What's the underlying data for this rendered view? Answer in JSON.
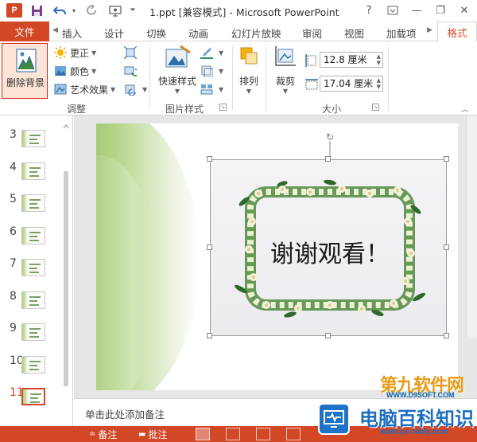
{
  "window": {
    "app_logo": "P",
    "title": "1.ppt [兼容模式] - Microsoft PowerPoint",
    "help": "?",
    "minimize": "—",
    "restore": "❐",
    "close": "✕"
  },
  "qat": {
    "save_icon": "save-icon",
    "undo_icon": "undo-icon",
    "redo_icon": "redo-icon",
    "present_icon": "present-icon",
    "customize_icon": "customize-icon"
  },
  "tabs": {
    "file": "文件",
    "items": [
      "插入",
      "设计",
      "切换",
      "动画",
      "幻灯片放映",
      "审阅",
      "视图",
      "加载项"
    ],
    "active": "格式"
  },
  "ribbon": {
    "adjust": {
      "remove_background": "删除背景",
      "corrections": "更正",
      "color": "颜色",
      "artistic_effects": "艺术效果",
      "label": "调整"
    },
    "picture_styles": {
      "quick_styles": "快速样式",
      "label": "图片样式"
    },
    "arrange": {
      "label": "排列"
    },
    "size": {
      "crop": "裁剪",
      "height": "12.8 厘米",
      "width": "17.04 厘米",
      "label": "大小"
    }
  },
  "thumbnails": [
    "3",
    "4",
    "5",
    "6",
    "7",
    "8",
    "9",
    "10",
    "11"
  ],
  "selected_slide": "11",
  "slide": {
    "text": "谢谢观看！"
  },
  "notes": {
    "placeholder": "单击此处添加备注"
  },
  "statusbar": {
    "notes": "备注",
    "comments": "批注"
  },
  "watermarks": {
    "wm1_big": "第九软件网",
    "wm1_small": "WWW.D9SOFT.COM",
    "wm2_big": "电脑百科知识",
    "wm2_small": "www.pc-daily.com"
  },
  "colors": {
    "accent": "#d24726",
    "highlight_border": "#e02020",
    "slide_green": "#7fb24a"
  }
}
